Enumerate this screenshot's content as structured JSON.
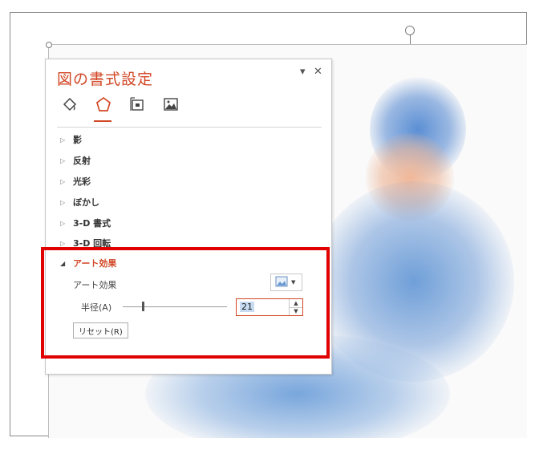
{
  "pane": {
    "title": "図の書式設定",
    "dropdown_glyph": "▾",
    "close_glyph": "✕",
    "tabs": [
      {
        "icon": "fill-bucket-icon"
      },
      {
        "icon": "pentagon-effects-icon",
        "selected": true
      },
      {
        "icon": "size-layout-icon"
      },
      {
        "icon": "picture-icon"
      }
    ],
    "sections": [
      {
        "label": "影",
        "expanded": false
      },
      {
        "label": "反射",
        "expanded": false
      },
      {
        "label": "光彩",
        "expanded": false
      },
      {
        "label": "ぼかし",
        "expanded": false
      },
      {
        "label": "3-D 書式",
        "expanded": false
      },
      {
        "label": "3-D 回転",
        "expanded": false
      },
      {
        "label": "アート効果",
        "expanded": true
      }
    ],
    "art_effect_label": "アート効果",
    "radius_label": "半径(A)",
    "radius_value": "21",
    "reset_label": "リセット(R)"
  },
  "colors": {
    "accent": "#d24726",
    "highlight_box": "#e00000"
  }
}
